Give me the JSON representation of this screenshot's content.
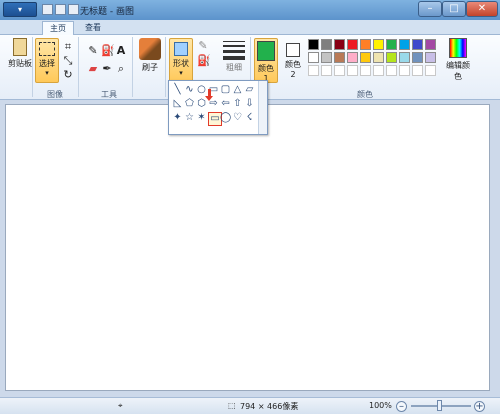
{
  "titlebar": {
    "title": "无标题 - 画图",
    "menu_label": "▾",
    "min_label": "–",
    "max_label": "□",
    "close_label": "✕"
  },
  "tabs": [
    {
      "label": "主页",
      "active": true
    },
    {
      "label": "查看",
      "active": false
    }
  ],
  "ribbon": {
    "clipboard": {
      "label": "剪贴板",
      "group_label": ""
    },
    "image": {
      "select_label": "选择",
      "group_label": "图像"
    },
    "tools": {
      "group_label": "工具"
    },
    "brushes": {
      "label": "刷子"
    },
    "shapes": {
      "label": "形状"
    },
    "size": {
      "label": "粗细"
    },
    "color1": {
      "label": "颜色 1",
      "color": "#22b14c"
    },
    "color2": {
      "label": "颜色 2",
      "color": "#ffffff"
    },
    "palette": [
      "#000000",
      "#7f7f7f",
      "#880015",
      "#ed1c24",
      "#ff7f27",
      "#fff200",
      "#22b14c",
      "#00a2e8",
      "#3f48cc",
      "#a349a4",
      "#ffffff",
      "#c3c3c3",
      "#b97a57",
      "#ffaec9",
      "#ffc90e",
      "#efe4b0",
      "#b5e61d",
      "#99d9ea",
      "#7092be",
      "#c8bfe7"
    ],
    "edit_colors_label": "编辑颜色",
    "colors_group_label": "颜色"
  },
  "shapes_popup": {
    "shapes": [
      "╲",
      "∿",
      "○",
      "▭",
      "▢",
      "△",
      "▱",
      "◺",
      "⬠",
      "⬡",
      "⇨",
      "⇦",
      "⇧",
      "⇩",
      "✦",
      "☆",
      "✶",
      "▭",
      "◯",
      "♡",
      "☇"
    ],
    "selected_index": 17
  },
  "status": {
    "canvas_size": "794 × 466像素",
    "zoom": "100%"
  },
  "colors": {
    "accent": "#ffc95a",
    "selection_border": "#e23a2a"
  }
}
